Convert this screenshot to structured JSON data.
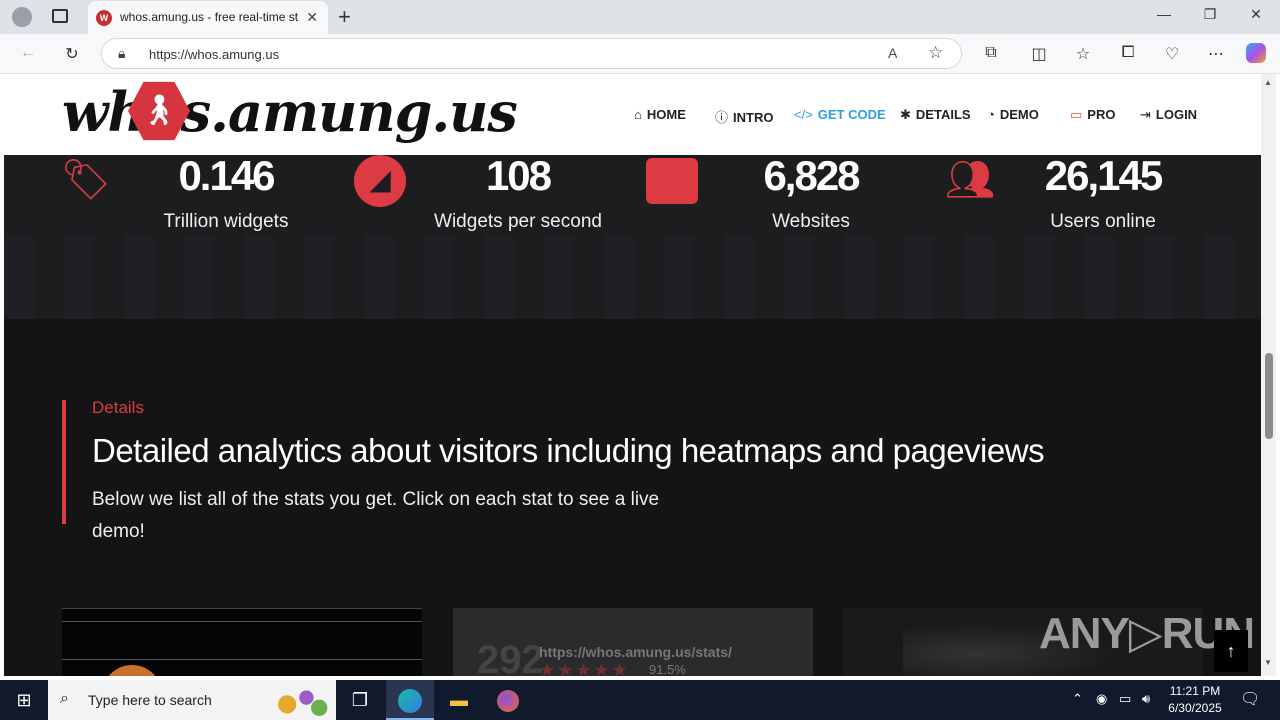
{
  "browser": {
    "tab_title": "whos.amung.us - free real-time st",
    "url": "https://whos.amung.us",
    "tab_close": "✕",
    "new_tab": "+"
  },
  "site": {
    "logo_text": "whos.amung.us",
    "nav": [
      {
        "label": "HOME",
        "icon": "home-icon"
      },
      {
        "label": "INTRO",
        "icon": "info-icon"
      },
      {
        "label": "GET CODE",
        "icon": "code-icon"
      },
      {
        "label": "DETAILS",
        "icon": "asterisk-icon"
      },
      {
        "label": "DEMO",
        "icon": "dashboard-icon"
      },
      {
        "label": "PRO",
        "icon": "pro-badge-icon"
      },
      {
        "label": "LOGIN",
        "icon": "login-icon"
      }
    ],
    "active_nav": "GET CODE",
    "accent_color": "#dd3b43"
  },
  "stats": [
    {
      "value": "0.146",
      "label": "Trillion widgets",
      "icon": "tags-icon"
    },
    {
      "value": "108",
      "label": "Widgets per second",
      "icon": "speedometer-icon"
    },
    {
      "value": "6,828",
      "label": "Websites",
      "icon": "window-icon"
    },
    {
      "value": "26,145",
      "label": "Users online",
      "icon": "users-icon"
    }
  ],
  "details": {
    "kicker": "Details",
    "heading": "Detailed analytics about visitors including heatmaps and pageviews",
    "description": "Below we list all of the stats you get. Click on each stat to see a live demo!"
  },
  "cards": {
    "card2_number": "292",
    "card2_url": "https://whos.amung.us/stats/",
    "card2_stars": "★★★★★",
    "card2_percent": "91.5%"
  },
  "watermark": "ANY▷RUN",
  "taskbar": {
    "search_placeholder": "Type here to search",
    "time": "11:21 PM",
    "date": "6/30/2025"
  }
}
